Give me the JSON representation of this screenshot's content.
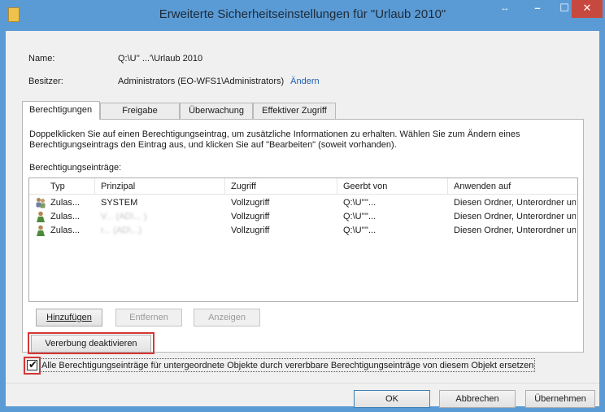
{
  "window": {
    "title": "Erweiterte Sicherheitseinstellungen für \"Urlaub 2010\"",
    "extra_button": "↔",
    "minimize": "–",
    "maximize": "☐",
    "close": "✕"
  },
  "info": {
    "name_label": "Name:",
    "name_value": "Q:\\U'' ...'\\Urlaub 2010",
    "owner_label": "Besitzer:",
    "owner_value": "Administrators (EO-WFS1\\Administrators)",
    "owner_change_link": "Ändern"
  },
  "tabs": [
    "Berechtigungen",
    "Freigabe",
    "Überwachung",
    "Effektiver Zugriff"
  ],
  "panel": {
    "description": "Doppelklicken Sie auf einen Berechtigungseintrag, um zusätzliche Informationen zu erhalten. Wählen Sie zum Ändern eines Berechtigungseintrags den Eintrag aus, und klicken Sie auf \"Bearbeiten\" (soweit vorhanden).",
    "entries_label": "Berechtigungseinträge:",
    "columns": [
      "Typ",
      "Prinzipal",
      "Zugriff",
      "Geerbt von",
      "Anwenden auf"
    ],
    "rows": [
      {
        "icon": "group-users-icon",
        "typ": "Zulas...",
        "prinzipal": "SYSTEM",
        "zugriff": "Vollzugriff",
        "geerbt": "Q:\\U''''...",
        "anwenden": "Diesen Ordner, Unterordner un..."
      },
      {
        "icon": "user-icon",
        "typ": "Zulas...",
        "prinzipal": "V... (AD\\... )",
        "zugriff": "Vollzugriff",
        "geerbt": "Q:\\U''''...",
        "anwenden": "Diesen Ordner, Unterordner un..."
      },
      {
        "icon": "user-icon",
        "typ": "Zulas...",
        "prinzipal": "r... (AD\\...)",
        "zugriff": "Vollzugriff",
        "geerbt": "Q:\\U''''...",
        "anwenden": "Diesen Ordner, Unterordner un..."
      }
    ],
    "add_button": "Hinzufügen",
    "remove_button": "Entfernen",
    "view_button": "Anzeigen",
    "disable_inheritance_button": "Vererbung deaktivieren",
    "replace_checkbox_label": "Alle Berechtigungseinträge für untergeordnete Objekte durch vererbbare Berechtigungseinträge von diesem Objekt ersetzen",
    "replace_checkbox_checked": true
  },
  "footer": {
    "ok": "OK",
    "cancel": "Abbrechen",
    "apply": "Übernehmen"
  },
  "colors": {
    "title_bar": "#5b9bd5",
    "close_button": "#c7483f",
    "highlight_box": "#d63636",
    "link": "#1f5fb2"
  }
}
